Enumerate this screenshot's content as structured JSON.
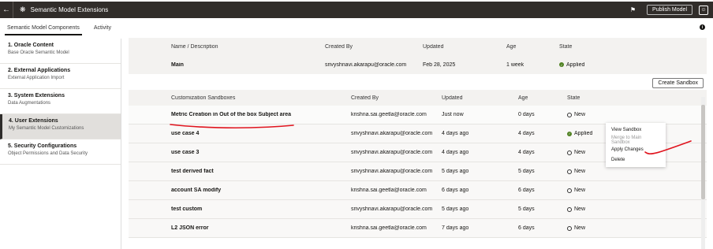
{
  "titlebar": {
    "title": "Semantic Model Extensions",
    "publish_label": "Publish Model",
    "icons": [
      "back-arrow-icon",
      "gear-icon",
      "bell-icon",
      "user-avatar-icon"
    ]
  },
  "tabs": [
    {
      "label": "Semantic Model Components",
      "active": true
    },
    {
      "label": "Activity",
      "active": false
    }
  ],
  "sidebar": {
    "items": [
      {
        "title": "1. Oracle Content",
        "sub": "Base Oracle Semantic Model"
      },
      {
        "title": "2. External Applications",
        "sub": "External Application Import"
      },
      {
        "title": "3. System Extensions",
        "sub": "Data Augmentations"
      },
      {
        "title": "4. User Extensions",
        "sub": "My Semantic Model Customizations",
        "active": true
      },
      {
        "title": "5. Security Configurations",
        "sub": "Object Permissions and Data Security"
      }
    ]
  },
  "main_table": {
    "headers": [
      "Name / Description",
      "Created By",
      "Updated",
      "Age",
      "State"
    ],
    "rows": [
      {
        "name": "Main",
        "created_by": "srivyshnavi.akarapu@oracle.com",
        "updated": "Feb 28, 2025",
        "age": "1 week",
        "state": "Applied"
      }
    ]
  },
  "create_sandbox_label": "Create Sandbox",
  "sandbox_table": {
    "headers": [
      "Customization Sandboxes",
      "Created By",
      "Updated",
      "Age",
      "State"
    ],
    "rows": [
      {
        "name": "Metric Creation in Out of the box Subject area",
        "created_by": "krishna.sai.geetla@oracle.com",
        "updated": "Just now",
        "age": "0 days",
        "state": "New"
      },
      {
        "name": "use case 4",
        "created_by": "srivyshnavi.akarapu@oracle.com",
        "updated": "4 days ago",
        "age": "4 days",
        "state": "Applied"
      },
      {
        "name": "use case 3",
        "created_by": "srivyshnavi.akarapu@oracle.com",
        "updated": "4 days ago",
        "age": "4 days",
        "state": "New"
      },
      {
        "name": "test derived fact",
        "created_by": "srivyshnavi.akarapu@oracle.com",
        "updated": "5 days ago",
        "age": "5 days",
        "state": "New"
      },
      {
        "name": "account SA modify",
        "created_by": "krishna.sai.geetla@oracle.com",
        "updated": "6 days ago",
        "age": "6 days",
        "state": "New"
      },
      {
        "name": "test custom",
        "created_by": "srivyshnavi.akarapu@oracle.com",
        "updated": "5 days ago",
        "age": "5 days",
        "state": "New"
      },
      {
        "name": "L2 JSON error",
        "created_by": "krishna.sai.geetla@oracle.com",
        "updated": "7 days ago",
        "age": "6 days",
        "state": "New"
      }
    ]
  },
  "context_menu": [
    {
      "label": "View Sandbox",
      "disabled": false
    },
    {
      "label": "Merge to Main Sandbox",
      "disabled": true
    },
    {
      "label": "Apply Changes",
      "disabled": false
    },
    {
      "label": "Delete",
      "disabled": false
    }
  ],
  "colors": {
    "titlebar": "#312d2a",
    "applied": "#508223",
    "annotation": "#e0141e"
  }
}
